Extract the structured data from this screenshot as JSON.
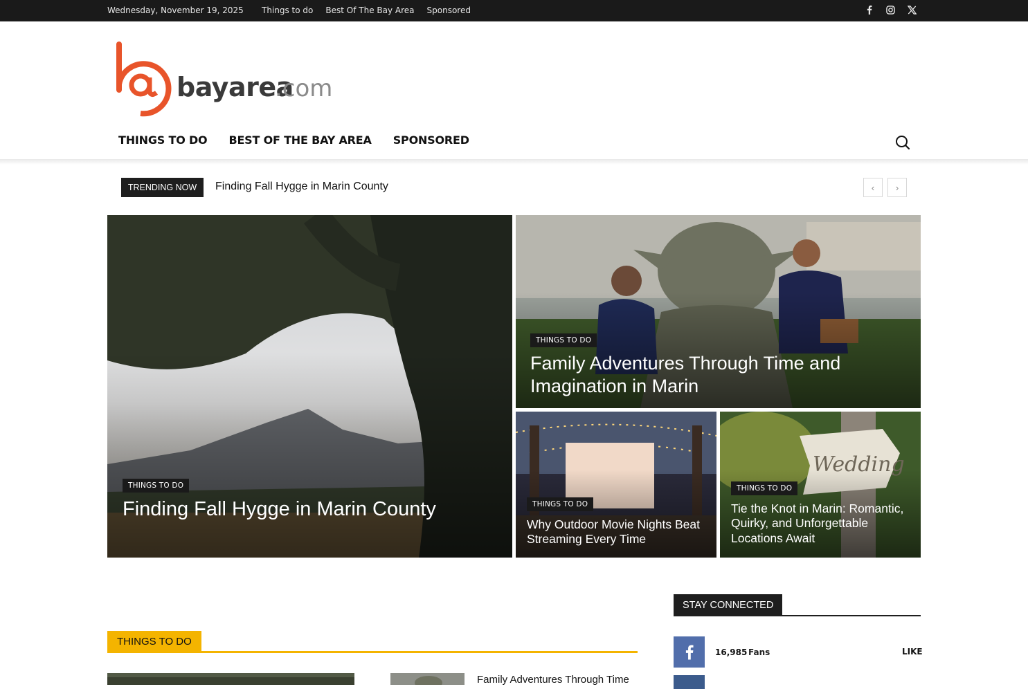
{
  "topbar": {
    "date": "Wednesday, November 19, 2025",
    "links": [
      "Things to do",
      "Best Of The Bay Area",
      "Sponsored"
    ],
    "socials": [
      "facebook-icon",
      "instagram-icon",
      "x-icon"
    ]
  },
  "logo": {
    "mark": "@",
    "name": "bayarea",
    "tld": ".com"
  },
  "nav": {
    "items": [
      "THINGS TO DO",
      "BEST OF THE BAY AREA",
      "SPONSORED"
    ]
  },
  "trending": {
    "label": "TRENDING NOW",
    "title": "Finding Fall Hygge in Marin County",
    "prev": "‹",
    "next": "›"
  },
  "featured": [
    {
      "category": "THINGS TO DO",
      "title": "Finding Fall Hygge in Marin County"
    },
    {
      "category": "THINGS TO DO",
      "title": "Family Adventures Through Time and Imagination in Marin"
    },
    {
      "category": "THINGS TO DO",
      "title": "Why Outdoor Movie Nights Beat Streaming Every Time"
    },
    {
      "category": "THINGS TO DO",
      "title": "Tie the Knot in Marin: Romantic, Quirky, and Unforgettable Locations Await",
      "sign_text": "Wedding"
    }
  ],
  "section": {
    "title": "THINGS TO DO",
    "first_small_title": "Family Adventures Through Time"
  },
  "stay_connected": {
    "title": "STAY CONNECTED",
    "facebook": {
      "count": "16,985",
      "label": "Fans",
      "action": "LIKE"
    }
  },
  "colors": {
    "accent": "#f4b400",
    "brand": "#e8542a",
    "dark": "#1a1a1a",
    "facebook": "#516eab"
  }
}
